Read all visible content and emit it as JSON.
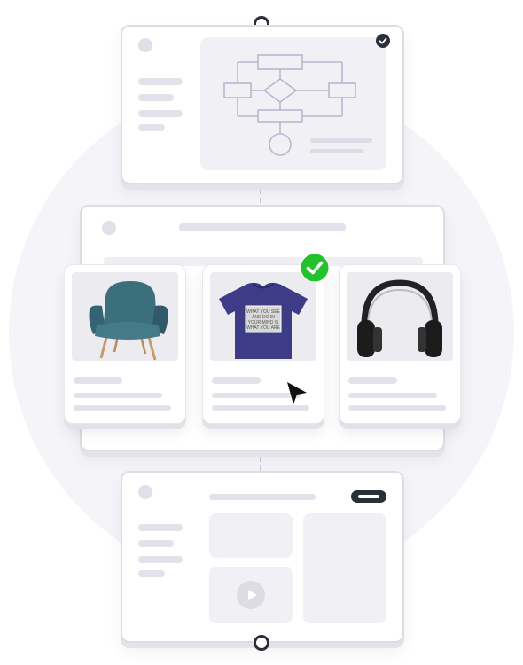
{
  "product_cards": [
    {
      "name": "armchair",
      "selected": false
    },
    {
      "name": "tshirt",
      "selected": true,
      "shirt_print": "WHAT YOU SEE AND DO IN YOUR MIND IS WHAT YOU ARE"
    },
    {
      "name": "headphones",
      "selected": false
    }
  ],
  "colors": {
    "accent_green": "#22c22c",
    "node_dark": "#2b2f3a",
    "tshirt_navy": "#3e3b87",
    "chair_teal": "#3c6f7c"
  }
}
